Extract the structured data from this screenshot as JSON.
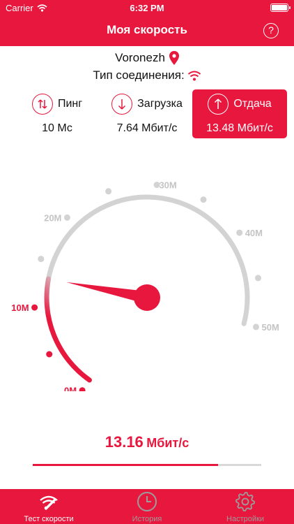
{
  "status_bar": {
    "carrier": "Carrier",
    "time": "6:32 PM"
  },
  "header": {
    "title": "Моя скорость",
    "help_label": "?"
  },
  "location": {
    "city": "Voronezh",
    "connection_label": "Тип соединения:"
  },
  "metrics": {
    "ping": {
      "label": "Пинг",
      "value": "10 Мс"
    },
    "download": {
      "label": "Загрузка",
      "value": "7.64 Мбит/с"
    },
    "upload": {
      "label": "Отдача",
      "value": "13.48 Мбит/с",
      "selected": true
    }
  },
  "gauge": {
    "labels": [
      "0M",
      "10M",
      "20M",
      "30M",
      "40M",
      "50M"
    ],
    "min": 0,
    "max": 50,
    "current": 13.16
  },
  "speed": {
    "value": "13.16",
    "unit": "Мбит/с"
  },
  "progress": 0.81,
  "tabs": [
    {
      "label": "Тест скорости",
      "icon": "speedometer-icon",
      "active": true
    },
    {
      "label": "История",
      "icon": "clock-icon",
      "active": false
    },
    {
      "label": "Настройки",
      "icon": "gear-icon",
      "active": false
    }
  ],
  "colors": {
    "accent": "#e8173d",
    "inactive": "#9c9c9c",
    "track": "#d9d9d9"
  }
}
